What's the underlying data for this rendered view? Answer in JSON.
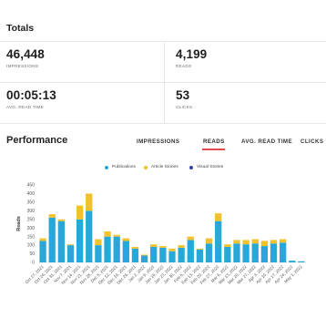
{
  "totals": {
    "title": "Totals",
    "impressions": {
      "value": "46,448",
      "label": "IMPRESSIONS"
    },
    "reads": {
      "value": "4,199",
      "label": "READS"
    },
    "avg_read_time": {
      "value": "00:05:13",
      "label": "AVG. READ TIME"
    },
    "clicks": {
      "value": "53",
      "label": "CLICKS"
    }
  },
  "performance": {
    "title": "Performance",
    "tabs": [
      {
        "label": "IMPRESSIONS"
      },
      {
        "label": "READS"
      },
      {
        "label": "AVG. READ TIME"
      },
      {
        "label": "CLICKS"
      }
    ],
    "active_tab": "READS"
  },
  "colors": {
    "publications": "#27a8d8",
    "article_stories": "#f2c12e",
    "visual_stories": "#3b3f9e",
    "accent": "#e5484d"
  },
  "chart_data": {
    "type": "bar",
    "stacked": true,
    "ylabel": "Reads",
    "ylim": [
      0,
      450
    ],
    "yticks": [
      0,
      50,
      100,
      150,
      200,
      250,
      300,
      350,
      400,
      450
    ],
    "legend_position": "top",
    "categories": [
      "Oct 17, 2021",
      "Oct 24, 2021",
      "Oct 31, 2021",
      "Nov 7, 2021",
      "Nov 14, 2021",
      "Nov 21, 2021",
      "Nov 28, 2021",
      "Dec 5, 2021",
      "Dec 12, 2021",
      "Dec 19, 2021",
      "Dec 26, 2021",
      "Jan 2, 2022",
      "Jan 9, 2022",
      "Jan 16, 2022",
      "Jan 23, 2022",
      "Jan 30, 2022",
      "Feb 6, 2022",
      "Feb 13, 2022",
      "Feb 20, 2022",
      "Feb 27, 2022",
      "Mar 6, 2022",
      "Mar 13, 2022",
      "Mar 20, 2022",
      "Mar 27, 2022",
      "Apr 3, 2022",
      "Apr 10, 2022",
      "Apr 17, 2022",
      "Apr 24, 2022",
      "May 1, 2022"
    ],
    "series": [
      {
        "name": "Publications",
        "values": [
          125,
          260,
          240,
          100,
          250,
          300,
          100,
          150,
          150,
          125,
          80,
          40,
          90,
          85,
          65,
          85,
          130,
          75,
          110,
          240,
          90,
          110,
          105,
          110,
          95,
          110,
          115,
          10,
          0
        ]
      },
      {
        "name": "Article Stories",
        "values": [
          15,
          20,
          10,
          5,
          80,
          100,
          35,
          30,
          10,
          15,
          10,
          5,
          15,
          10,
          15,
          15,
          20,
          5,
          30,
          45,
          15,
          20,
          25,
          25,
          30,
          20,
          20,
          0,
          0
        ]
      },
      {
        "name": "Visual Stories",
        "values": [
          0,
          0,
          0,
          0,
          0,
          0,
          0,
          0,
          0,
          0,
          0,
          0,
          0,
          0,
          0,
          0,
          0,
          0,
          0,
          0,
          0,
          0,
          0,
          0,
          0,
          0,
          0,
          0,
          0
        ]
      }
    ]
  }
}
